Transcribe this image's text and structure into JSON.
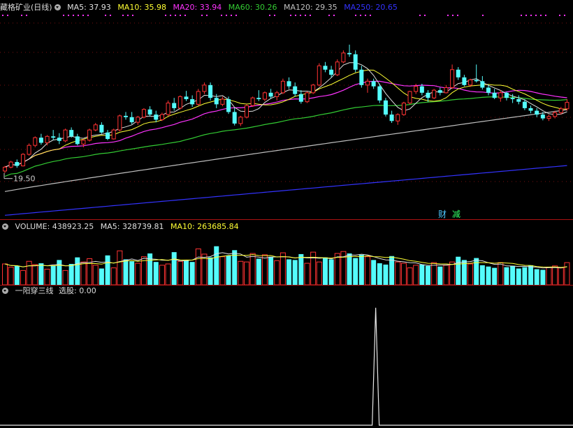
{
  "header": {
    "stock_name": "藏格矿业(日线)",
    "ma5": "MA5: 37.93",
    "ma10": "MA10: 35.98",
    "ma20": "MA20: 33.94",
    "ma60": "MA60: 30.26",
    "ma120": "MA120: 29.35",
    "ma250": "MA250: 20.65"
  },
  "volume_header": {
    "volume": "VOLUME: 438923.25",
    "ma5": "MA5: 328739.81",
    "ma10": "MA10: 263685.84"
  },
  "indicator_header": {
    "name": "一阳穿三线",
    "value": "选股: 0.00"
  },
  "tags": {
    "cai": "财",
    "jian": "减"
  },
  "colors": {
    "up": "#ff3333",
    "down": "#54fcfc",
    "ma5": "#e0e0e0",
    "ma10": "#ffff33",
    "ma20": "#ff33ff",
    "ma60": "#33cc33",
    "ma120": "#c0c0c0",
    "ma250": "#3333ff"
  },
  "chart_data": [
    {
      "type": "candlestick",
      "low_label": "19.50",
      "ylim": [
        12.5,
        44.5
      ],
      "ohlc": [
        [
          19.8,
          20.6,
          19.5,
          20.4
        ],
        [
          20.4,
          21.4,
          20.2,
          21.2
        ],
        [
          21.2,
          21.6,
          20.3,
          20.6
        ],
        [
          20.6,
          22.6,
          20.5,
          22.4
        ],
        [
          22.4,
          24.1,
          22.2,
          23.8
        ],
        [
          23.8,
          25.2,
          23.5,
          25.0
        ],
        [
          25.0,
          25.6,
          23.9,
          24.2
        ],
        [
          24.2,
          25.4,
          23.8,
          25.2
        ],
        [
          25.2,
          26.2,
          24.6,
          25.0
        ],
        [
          25.0,
          25.7,
          24.0,
          24.5
        ],
        [
          24.5,
          26.4,
          24.3,
          26.2
        ],
        [
          26.2,
          26.6,
          25.0,
          25.2
        ],
        [
          25.2,
          25.6,
          23.8,
          24.0
        ],
        [
          24.0,
          24.8,
          23.5,
          24.6
        ],
        [
          24.6,
          26.4,
          24.4,
          26.2
        ],
        [
          26.2,
          27.3,
          26.0,
          27.0
        ],
        [
          27.0,
          27.4,
          25.6,
          25.8
        ],
        [
          25.8,
          26.2,
          24.6,
          24.8
        ],
        [
          24.8,
          26.4,
          24.7,
          26.2
        ],
        [
          26.2,
          28.6,
          26.0,
          28.4
        ],
        [
          28.4,
          29.0,
          27.8,
          28.2
        ],
        [
          28.2,
          29.0,
          27.1,
          27.4
        ],
        [
          27.4,
          28.4,
          27.0,
          28.2
        ],
        [
          28.2,
          29.6,
          28.0,
          29.4
        ],
        [
          29.4,
          29.9,
          28.3,
          28.6
        ],
        [
          28.6,
          29.2,
          27.4,
          27.8
        ],
        [
          27.8,
          28.9,
          27.6,
          28.6
        ],
        [
          28.6,
          30.8,
          28.4,
          30.4
        ],
        [
          30.4,
          31.2,
          29.2,
          29.6
        ],
        [
          29.6,
          31.6,
          29.4,
          31.4
        ],
        [
          31.4,
          32.3,
          30.7,
          31.0
        ],
        [
          31.0,
          31.6,
          29.8,
          30.2
        ],
        [
          30.2,
          32.6,
          30.0,
          32.2
        ],
        [
          32.2,
          33.6,
          31.8,
          33.2
        ],
        [
          33.2,
          33.6,
          30.8,
          31.2
        ],
        [
          31.2,
          31.8,
          29.6,
          30.2
        ],
        [
          30.2,
          31.4,
          29.9,
          31.0
        ],
        [
          31.0,
          31.4,
          28.7,
          29.0
        ],
        [
          29.0,
          29.6,
          26.9,
          27.2
        ],
        [
          27.2,
          28.4,
          26.8,
          28.2
        ],
        [
          28.2,
          30.2,
          28.0,
          30.0
        ],
        [
          30.0,
          31.4,
          29.8,
          31.2
        ],
        [
          31.2,
          32.4,
          30.7,
          31.0
        ],
        [
          31.0,
          32.2,
          30.7,
          32.0
        ],
        [
          32.0,
          32.6,
          31.1,
          31.4
        ],
        [
          31.4,
          32.3,
          30.8,
          32.0
        ],
        [
          32.0,
          34.2,
          31.8,
          33.8
        ],
        [
          33.8,
          34.4,
          32.6,
          33.0
        ],
        [
          33.0,
          33.6,
          31.4,
          31.8
        ],
        [
          31.8,
          32.4,
          30.3,
          30.6
        ],
        [
          30.6,
          32.2,
          30.4,
          32.0
        ],
        [
          32.0,
          33.4,
          31.8,
          33.2
        ],
        [
          33.2,
          36.6,
          33.0,
          36.2
        ],
        [
          36.2,
          36.8,
          35.2,
          35.6
        ],
        [
          35.6,
          36.2,
          34.4,
          34.8
        ],
        [
          34.8,
          37.2,
          34.6,
          36.8
        ],
        [
          36.8,
          38.6,
          36.6,
          38.2
        ],
        [
          38.2,
          39.5,
          37.6,
          38.0
        ],
        [
          38.0,
          38.6,
          35.2,
          35.6
        ],
        [
          35.6,
          36.2,
          32.8,
          33.2
        ],
        [
          33.2,
          34.2,
          32.0,
          33.8
        ],
        [
          33.8,
          34.2,
          32.6,
          33.0
        ],
        [
          33.0,
          33.4,
          30.4,
          30.8
        ],
        [
          30.8,
          31.2,
          28.3,
          28.6
        ],
        [
          28.6,
          29.2,
          27.3,
          27.6
        ],
        [
          27.6,
          28.8,
          27.0,
          28.6
        ],
        [
          28.6,
          30.6,
          28.4,
          30.4
        ],
        [
          30.4,
          32.3,
          30.2,
          32.2
        ],
        [
          32.2,
          33.4,
          31.8,
          33.0
        ],
        [
          33.0,
          33.4,
          31.6,
          32.0
        ],
        [
          32.0,
          32.4,
          30.6,
          31.2
        ],
        [
          31.2,
          32.6,
          31.0,
          32.4
        ],
        [
          32.4,
          32.8,
          31.6,
          32.0
        ],
        [
          32.0,
          33.2,
          31.9,
          32.8
        ],
        [
          32.8,
          36.4,
          32.6,
          35.6
        ],
        [
          35.6,
          36.0,
          34.0,
          34.4
        ],
        [
          34.4,
          34.8,
          33.0,
          33.2
        ],
        [
          33.2,
          34.2,
          32.9,
          34.0
        ],
        [
          34.0,
          36.4,
          33.6,
          33.8
        ],
        [
          33.8,
          34.6,
          32.5,
          32.8
        ],
        [
          32.8,
          33.2,
          31.6,
          32.0
        ],
        [
          32.0,
          32.6,
          31.0,
          31.2
        ],
        [
          31.2,
          32.4,
          30.6,
          32.0
        ],
        [
          32.0,
          32.2,
          30.8,
          31.2
        ],
        [
          31.2,
          31.8,
          30.4,
          31.0
        ],
        [
          31.0,
          31.6,
          30.2,
          30.6
        ],
        [
          30.6,
          31.0,
          29.3,
          29.6
        ],
        [
          29.6,
          30.0,
          28.8,
          29.2
        ],
        [
          29.2,
          29.6,
          28.2,
          28.6
        ],
        [
          28.6,
          29.0,
          27.7,
          28.0
        ],
        [
          28.0,
          28.6,
          27.6,
          28.3
        ],
        [
          28.3,
          29.2,
          28.0,
          28.9
        ],
        [
          28.9,
          29.8,
          28.6,
          29.5
        ],
        [
          29.5,
          31.0,
          29.2,
          30.5
        ]
      ]
    },
    {
      "type": "bar",
      "name": "VOLUME",
      "ylim": [
        0,
        80
      ],
      "values": [
        32,
        27,
        29,
        22,
        36,
        31,
        33,
        24,
        29,
        38,
        22,
        32,
        42,
        35,
        40,
        30,
        25,
        45,
        26,
        52,
        39,
        36,
        33,
        43,
        48,
        35,
        30,
        32,
        50,
        36,
        37,
        35,
        55,
        47,
        42,
        59,
        43,
        45,
        53,
        36,
        35,
        48,
        40,
        46,
        43,
        37,
        49,
        39,
        38,
        47,
        33,
        50,
        35,
        42,
        39,
        48,
        51,
        48,
        41,
        46,
        43,
        38,
        33,
        31,
        44,
        35,
        33,
        26,
        30,
        31,
        29,
        34,
        28,
        30,
        35,
        43,
        38,
        32,
        41,
        30,
        28,
        26,
        34,
        27,
        29,
        25,
        27,
        30,
        24,
        23,
        27,
        29,
        26,
        34
      ]
    },
    {
      "type": "line",
      "name": "一阳穿三线",
      "ylim": [
        0,
        1.1
      ],
      "spike_index": 61,
      "bar_count": 94
    }
  ]
}
